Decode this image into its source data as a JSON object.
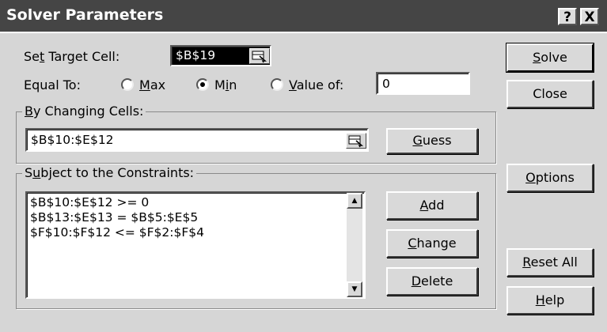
{
  "title": "Solver Parameters",
  "title_buttons": {
    "help": "?",
    "close": "X"
  },
  "target": {
    "label_pre": "Se",
    "label_key": "t",
    "label_post": " Target Cell:",
    "value": "$B$19"
  },
  "equal_to": {
    "label": "Equal To:",
    "max": {
      "pre": "",
      "key": "M",
      "post": "ax",
      "selected": false
    },
    "min": {
      "pre": "M",
      "key": "i",
      "post": "n",
      "selected": true
    },
    "value_of": {
      "pre": "",
      "key": "V",
      "post": "alue of:",
      "selected": false
    },
    "value": "0"
  },
  "changing": {
    "label_key": "B",
    "label_post": "y Changing Cells:",
    "value": "$B$10:$E$12"
  },
  "constraints": {
    "label_pre": "S",
    "label_key": "u",
    "label_post": "bject to the Constraints:",
    "items": [
      "$B$10:$E$12 >= 0",
      "$B$13:$E$13 = $B$5:$E$5",
      "$F$10:$F$12 <= $F$2:$F$4"
    ]
  },
  "buttons": {
    "solve": {
      "pre": "",
      "key": "S",
      "post": "olve"
    },
    "close": {
      "pre": "",
      "key": "",
      "post": "Close"
    },
    "guess": {
      "pre": "",
      "key": "G",
      "post": "uess"
    },
    "options": {
      "pre": "",
      "key": "O",
      "post": "ptions"
    },
    "add": {
      "pre": "",
      "key": "A",
      "post": "dd"
    },
    "change": {
      "pre": "",
      "key": "C",
      "post": "hange"
    },
    "delete": {
      "pre": "",
      "key": "D",
      "post": "elete"
    },
    "reset": {
      "pre": "",
      "key": "R",
      "post": "eset All"
    },
    "help": {
      "pre": "",
      "key": "H",
      "post": "elp"
    }
  },
  "icons": {
    "ref": "range-selector-icon",
    "up": "scroll-up-arrow",
    "down": "scroll-down-arrow"
  }
}
